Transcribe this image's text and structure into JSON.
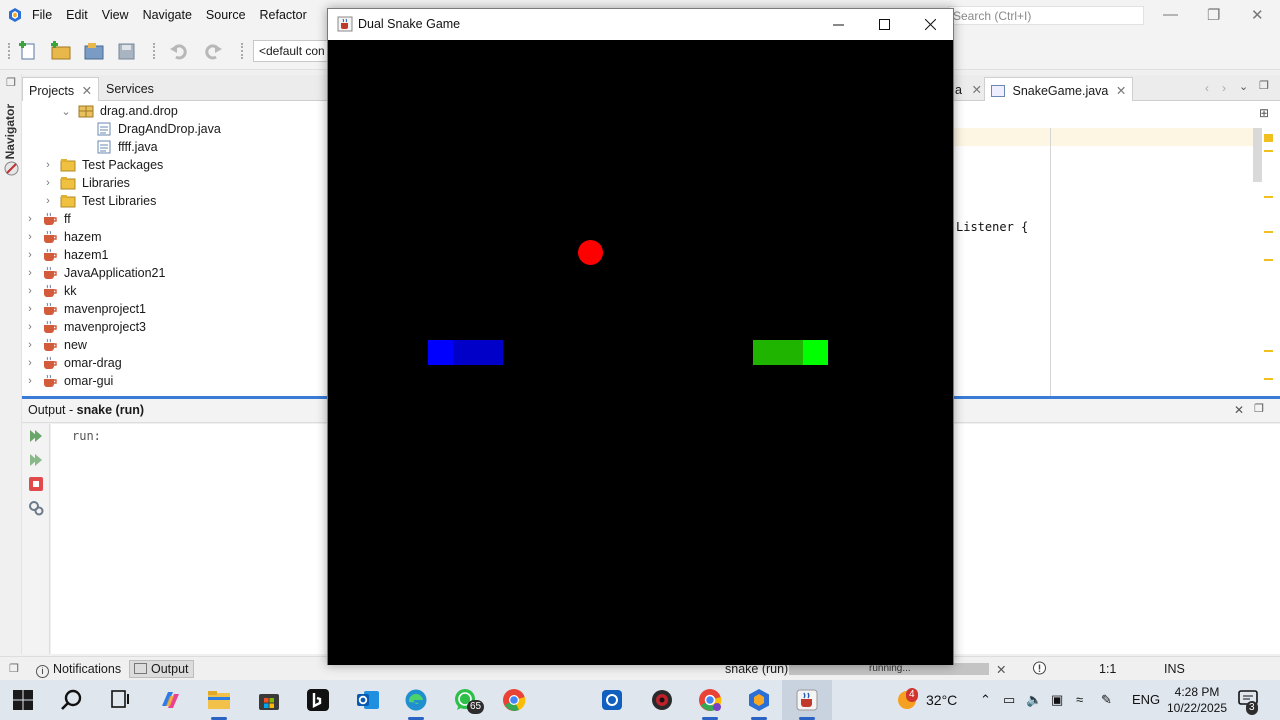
{
  "ide": {
    "menu": [
      "File",
      "Edit",
      "View",
      "Navigate",
      "Source",
      "Refactor"
    ],
    "search_placeholder": "Search (Ctrl+I)",
    "config_select": "<default con",
    "navigator_label": "Navigator",
    "projects_tabs": [
      "Projects",
      "Services"
    ],
    "tree": [
      {
        "label": "drag.and.drop",
        "icon": "package-icon",
        "depth": 2,
        "expanded": true
      },
      {
        "label": "DragAndDrop.java",
        "icon": "java-file-icon",
        "depth": 3
      },
      {
        "label": "ffff.java",
        "icon": "java-file-icon",
        "depth": 3
      },
      {
        "label": "Test Packages",
        "icon": "folder-icon",
        "depth": 1,
        "expanded": false
      },
      {
        "label": "Libraries",
        "icon": "folder-icon",
        "depth": 1,
        "expanded": false
      },
      {
        "label": "Test Libraries",
        "icon": "folder-icon",
        "depth": 1,
        "expanded": false
      },
      {
        "label": "ff",
        "icon": "project-icon",
        "depth": 0,
        "expanded": false
      },
      {
        "label": "hazem",
        "icon": "project-icon",
        "depth": 0,
        "expanded": false
      },
      {
        "label": "hazem1",
        "icon": "project-icon",
        "depth": 0,
        "expanded": false
      },
      {
        "label": "JavaApplication21",
        "icon": "project-icon",
        "depth": 0,
        "expanded": false
      },
      {
        "label": "kk",
        "icon": "project-icon",
        "depth": 0,
        "expanded": false
      },
      {
        "label": "mavenproject1",
        "icon": "project-icon",
        "depth": 0,
        "expanded": false
      },
      {
        "label": "mavenproject3",
        "icon": "project-icon",
        "depth": 0,
        "expanded": false
      },
      {
        "label": "new",
        "icon": "project-icon",
        "depth": 0,
        "expanded": false
      },
      {
        "label": "omar-drag",
        "icon": "project-icon",
        "depth": 0,
        "expanded": false
      },
      {
        "label": "omar-gui",
        "icon": "project-icon",
        "depth": 0,
        "expanded": false
      }
    ],
    "editor_tabs": [
      {
        "label": "a",
        "active": false
      },
      {
        "label": "SnakeGame.java",
        "active": true
      }
    ],
    "code_fragment": "Listener {",
    "output": {
      "title_prefix": "Output - ",
      "title_bold": "snake (run)",
      "text": "run:"
    },
    "status": {
      "notifications": "Notifications",
      "output_tab": "Output",
      "run_task": "snake (run)",
      "progress_text": "running...",
      "progress": 1.0,
      "position": "1:1",
      "mode": "INS"
    }
  },
  "game": {
    "title": "Dual Snake Game",
    "background": "#000000",
    "grid_cell": 25,
    "grid_cells_across": 25,
    "food": {
      "col": 10,
      "row": 8,
      "color": "#ff0000"
    },
    "snakes": [
      {
        "name": "blue",
        "head_color": "#0000ff",
        "body_color": "#0000c8",
        "cells": [
          [
            4,
            12
          ],
          [
            5,
            12
          ],
          [
            6,
            12
          ]
        ]
      },
      {
        "name": "green",
        "head_color": "#00ff00",
        "body_color": "#1eb400",
        "cells": [
          [
            19,
            12
          ],
          [
            18,
            12
          ],
          [
            17,
            12
          ]
        ]
      }
    ]
  },
  "taskbar": {
    "apps": [
      "start-icon",
      "search-icon",
      "task-view-icon",
      "copilot-icon",
      "file-explorer-icon",
      "store-icon",
      "bing-icon",
      "outlook-icon",
      "edge-icon",
      "whatsapp-icon",
      "chrome-icon",
      "snipping-icon",
      "app-icon",
      "chrome-profile-icon",
      "netbeans-icon",
      "java-icon"
    ],
    "whatsapp_badge": "65",
    "weather_badge": "4",
    "temperature": "32°C",
    "language": "ENG",
    "time": "4:28 PM",
    "date": "10/22/2025",
    "notification_count": "3"
  }
}
